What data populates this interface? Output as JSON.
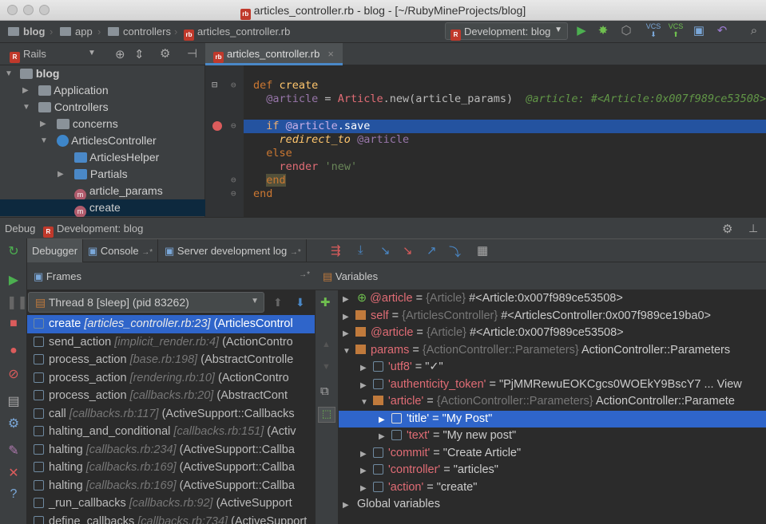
{
  "window": {
    "title": "articles_controller.rb - blog - [~/RubyMineProjects/blog]"
  },
  "navbar": {
    "crumbs": [
      "blog",
      "app",
      "controllers",
      "articles_controller.rb"
    ],
    "run_config": "Development: blog",
    "vcs_label_1": "VCS",
    "vcs_label_2": "VCS"
  },
  "project": {
    "view_label": "Rails",
    "tree": [
      {
        "label": "blog",
        "bold": true
      },
      {
        "label": "Application"
      },
      {
        "label": "Controllers"
      },
      {
        "label": "concerns"
      },
      {
        "label": "ArticlesController"
      },
      {
        "label": "ArticlesHelper"
      },
      {
        "label": "Partials"
      },
      {
        "label": "article_params"
      },
      {
        "label": "create"
      }
    ]
  },
  "editor": {
    "tab": "articles_controller.rb",
    "code": {
      "l1_kw": "def",
      "l1_fn": "create",
      "l2_iv": "@article",
      "l2_eq": " = ",
      "l2_cls": "Article",
      "l2_rest": ".new(article_params)",
      "l2_inline": "@article: #<Article:0x007f989ce53508>",
      "l3_kw": "if",
      "l3_iv": "@article",
      "l3_rest": ".save",
      "l4_call": "redirect_to",
      "l4_iv": "@article",
      "l5_kw": "else",
      "l6_call": "render",
      "l6_str": "'new'",
      "l7_kw": "end",
      "l8_kw": "end"
    }
  },
  "debug": {
    "label": "Debug",
    "config": "Development: blog",
    "tabs": [
      "Debugger",
      "Console",
      "Server development log"
    ],
    "console_suffix": "→*",
    "log_suffix": "→*",
    "frames_title": "Frames",
    "frames_pin": "→*",
    "variables_title": "Variables",
    "thread": "Thread 8 [sleep] (pid 83262)",
    "frames": [
      {
        "method": "create",
        "loc": "[articles_controller.rb:23]",
        "cls": "(ArticlesControl"
      },
      {
        "method": "send_action",
        "loc": "[implicit_render.rb:4]",
        "cls": "(ActionContro"
      },
      {
        "method": "process_action",
        "loc": "[base.rb:198]",
        "cls": "(AbstractControlle"
      },
      {
        "method": "process_action",
        "loc": "[rendering.rb:10]",
        "cls": "(ActionContro"
      },
      {
        "method": "process_action",
        "loc": "[callbacks.rb:20]",
        "cls": "(AbstractCont"
      },
      {
        "method": "call",
        "loc": "[callbacks.rb:117]",
        "cls": "(ActiveSupport::Callbacks"
      },
      {
        "method": "halting_and_conditional",
        "loc": "[callbacks.rb:151]",
        "cls": "(Activ"
      },
      {
        "method": "halting",
        "loc": "[callbacks.rb:234]",
        "cls": "(ActiveSupport::Callba"
      },
      {
        "method": "halting",
        "loc": "[callbacks.rb:169]",
        "cls": "(ActiveSupport::Callba"
      },
      {
        "method": "halting",
        "loc": "[callbacks.rb:169]",
        "cls": "(ActiveSupport::Callba"
      },
      {
        "method": "_run_callbacks",
        "loc": "[callbacks.rb:92]",
        "cls": "(ActiveSupport"
      },
      {
        "method": "define_callbacks",
        "loc": "[callbacks.rb:734]",
        "cls": "(ActiveSupport"
      }
    ],
    "variables": [
      {
        "name": "@article",
        "eq": " = ",
        "type": "{Article}",
        "value": " #<Article:0x007f989ce53508>"
      },
      {
        "name": "self",
        "eq": " = ",
        "type": "{ArticlesController}",
        "value": " #<ArticlesController:0x007f989ce19ba0>"
      },
      {
        "name": "@article",
        "eq": " = ",
        "type": "{Article}",
        "value": " #<Article:0x007f989ce53508>"
      },
      {
        "name": "params",
        "eq": " = ",
        "type": "{ActionController::Parameters}",
        "value": " ActionController::Parameters"
      },
      {
        "name": "'utf8'",
        "eq": " = ",
        "type": "",
        "value": "\"✓\""
      },
      {
        "name": "'authenticity_token'",
        "eq": " = ",
        "type": "",
        "value": "\"PjMMRewuEOKCgcs0WOEkY9BscY7 ... View"
      },
      {
        "name": "'article'",
        "eq": " = ",
        "type": "{ActionController::Parameters}",
        "value": " ActionController::Paramete"
      },
      {
        "name": "'title'",
        "eq": " = ",
        "type": "",
        "value": "\"My Post\""
      },
      {
        "name": "'text'",
        "eq": " = ",
        "type": "",
        "value": "\"My new post\""
      },
      {
        "name": "'commit'",
        "eq": " = ",
        "type": "",
        "value": "\"Create Article\""
      },
      {
        "name": "'controller'",
        "eq": " = ",
        "type": "",
        "value": "\"articles\""
      },
      {
        "name": "'action'",
        "eq": " = ",
        "type": "",
        "value": "\"create\""
      },
      {
        "name": "Global variables",
        "eq": "",
        "type": "",
        "value": ""
      }
    ]
  }
}
